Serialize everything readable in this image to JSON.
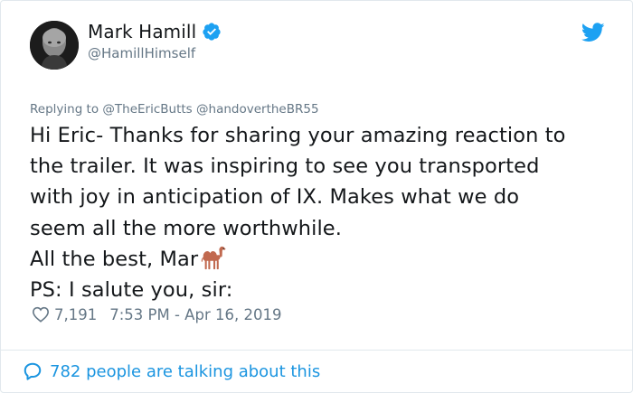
{
  "author": {
    "display_name": "Mark Hamill",
    "handle": "@HamillHimself",
    "verified": true
  },
  "reply": {
    "prefix": "Replying to",
    "mentions": [
      "@TheEricButts",
      "@handovertheBR55"
    ]
  },
  "tweet": {
    "lines": [
      "Hi Eric- Thanks for sharing your amazing reaction to",
      "the trailer. It was inspiring to see you transported",
      "with joy in anticipation of IX. Makes what we do",
      "seem all the more worthwhile.",
      "All the best, Mar",
      "PS: I salute you, sir:"
    ],
    "emoji": "camel-emoji"
  },
  "meta": {
    "likes": "7,191",
    "timestamp": "7:53 PM - Apr 16, 2019"
  },
  "conversation": {
    "label": "782 people are talking about this"
  },
  "colors": {
    "accent": "#1b95e0",
    "secondary_text": "#657786",
    "primary_text": "#14171a",
    "border": "#e1e8ed",
    "verified": "#1da1f2"
  },
  "icons": [
    "verified-badge-icon",
    "twitter-bird-icon",
    "heart-icon",
    "speech-bubble-icon",
    "camel-emoji"
  ]
}
